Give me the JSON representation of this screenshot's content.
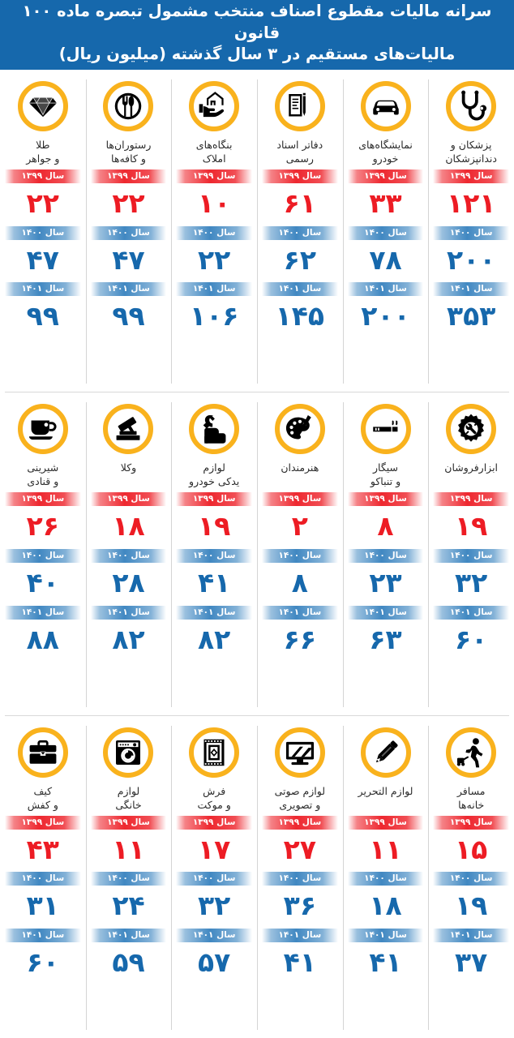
{
  "header": {
    "title": "سرانه مالیات مقطوع اصناف منتخب مشمول تبصره ماده ۱۰۰ قانون\nمالیات‌های مستقیم در ۳ سال گذشته (میلیون ریال)"
  },
  "year_labels": {
    "y1399": "سال ۱۳۹۹",
    "y1400": "سال ۱۴۰۰",
    "y1401": "سال ۱۴۰۱"
  },
  "colors": {
    "header_bg": "#1668ac",
    "badge_ring": "#f9b21d",
    "red": "#ed1c24",
    "blue": "#1668ac",
    "icon": "#000000",
    "divider": "#d4d4d4"
  },
  "chart_data": {
    "type": "table",
    "title": "سرانه مالیات مقطوع اصناف منتخب مشمول تبصره ماده ۱۰۰ قانون مالیات‌های مستقیم در ۳ سال گذشته (میلیون ریال)",
    "xlabel": "",
    "ylabel": "میلیون ریال",
    "categories": [
      "پزشکان و دندانپزشکان",
      "نمایشگاه‌های خودرو",
      "دفاتر اسناد رسمی",
      "بنگاه‌های املاک",
      "رستوران‌ها و کافه‌ها",
      "طلا و جواهر",
      "ابزارفروشان",
      "سیگار و تنباکو",
      "هنرمندان",
      "لوازم یدکی خودرو",
      "وکلا",
      "شیرینی و قنادی",
      "مسافرخانه‌ها",
      "لوازم التحریر",
      "لوازم صوتی و تصویری",
      "فرش و موکت",
      "لوازم خانگی",
      "کیف و کفش"
    ],
    "series": [
      {
        "name": "سال ۱۳۹۹",
        "color": "#ed1c24",
        "values": [
          121,
          33,
          61,
          10,
          22,
          22,
          19,
          8,
          2,
          19,
          18,
          26,
          15,
          11,
          27,
          17,
          11,
          43
        ]
      },
      {
        "name": "سال ۱۴۰۰",
        "color": "#1668ac",
        "values": [
          200,
          78,
          62,
          22,
          47,
          47,
          32,
          23,
          8,
          41,
          28,
          40,
          19,
          18,
          36,
          32,
          24,
          31
        ]
      },
      {
        "name": "سال ۱۴۰۱",
        "color": "#1668ac",
        "values": [
          353,
          200,
          145,
          106,
          99,
          99,
          60,
          63,
          66,
          82,
          82,
          88,
          37,
          41,
          41,
          57,
          59,
          60
        ]
      }
    ],
    "legend_position": "inline-band",
    "grid": false
  },
  "rows": [
    {
      "cards": [
        {
          "icon": "stethoscope-icon",
          "title": "پزشکان و\nدندانپزشکان",
          "v1399": "۱۲۱",
          "v1400": "۲۰۰",
          "v1401": "۳۵۳"
        },
        {
          "icon": "car-icon",
          "title": "نمایشگاه‌های\nخودرو",
          "v1399": "۳۳",
          "v1400": "۷۸",
          "v1401": "۲۰۰"
        },
        {
          "icon": "documents-icon",
          "title": "دفاتر اسناد\nرسمی",
          "v1399": "۶۱",
          "v1400": "۶۲",
          "v1401": "۱۴۵"
        },
        {
          "icon": "house-hand-icon",
          "title": "بنگاه‌های\nاملاک",
          "v1399": "۱۰",
          "v1400": "۲۲",
          "v1401": "۱۰۶"
        },
        {
          "icon": "cutlery-icon",
          "title": "رستوران‌ها\nو کافه‌ها",
          "v1399": "۲۲",
          "v1400": "۴۷",
          "v1401": "۹۹"
        },
        {
          "icon": "diamond-icon",
          "title": "طلا\nو جواهر",
          "v1399": "۲۲",
          "v1400": "۴۷",
          "v1401": "۹۹"
        }
      ]
    },
    {
      "cards": [
        {
          "icon": "gear-tools-icon",
          "title": "ابزارفروشان",
          "v1399": "۱۹",
          "v1400": "۳۲",
          "v1401": "۶۰"
        },
        {
          "icon": "cigarette-icon",
          "title": "سیگار\nو تنباکو",
          "v1399": "۸",
          "v1400": "۲۳",
          "v1401": "۶۳"
        },
        {
          "icon": "palette-icon",
          "title": "هنرمندان",
          "v1399": "۲",
          "v1400": "۸",
          "v1401": "۶۶"
        },
        {
          "icon": "wrench-hand-icon",
          "title": "لوازم\nیدکی خودرو",
          "v1399": "۱۹",
          "v1400": "۴۱",
          "v1401": "۸۲"
        },
        {
          "icon": "gavel-icon",
          "title": "وکلا",
          "v1399": "۱۸",
          "v1400": "۲۸",
          "v1401": "۸۲"
        },
        {
          "icon": "coffee-cup-icon",
          "title": "شیرینی\nو قنادی",
          "v1399": "۲۶",
          "v1400": "۴۰",
          "v1401": "۸۸"
        }
      ]
    },
    {
      "cards": [
        {
          "icon": "traveler-icon",
          "title": "مسافر\nخانه‌ها",
          "v1399": "۱۵",
          "v1400": "۱۹",
          "v1401": "۳۷"
        },
        {
          "icon": "pencil-icon",
          "title": "لوازم التحریر",
          "v1399": "۱۱",
          "v1400": "۱۸",
          "v1401": "۴۱"
        },
        {
          "icon": "monitor-icon",
          "title": "لوازم صوتی\nو تصویری",
          "v1399": "۲۷",
          "v1400": "۳۶",
          "v1401": "۴۱"
        },
        {
          "icon": "carpet-icon",
          "title": "فرش\nو موکت",
          "v1399": "۱۷",
          "v1400": "۳۲",
          "v1401": "۵۷"
        },
        {
          "icon": "washing-machine-icon",
          "title": "لوازم\nخانگی",
          "v1399": "۱۱",
          "v1400": "۲۴",
          "v1401": "۵۹"
        },
        {
          "icon": "briefcase-icon",
          "title": "کیف\nو کفش",
          "v1399": "۴۳",
          "v1400": "۳۱",
          "v1401": "۶۰"
        }
      ]
    }
  ]
}
